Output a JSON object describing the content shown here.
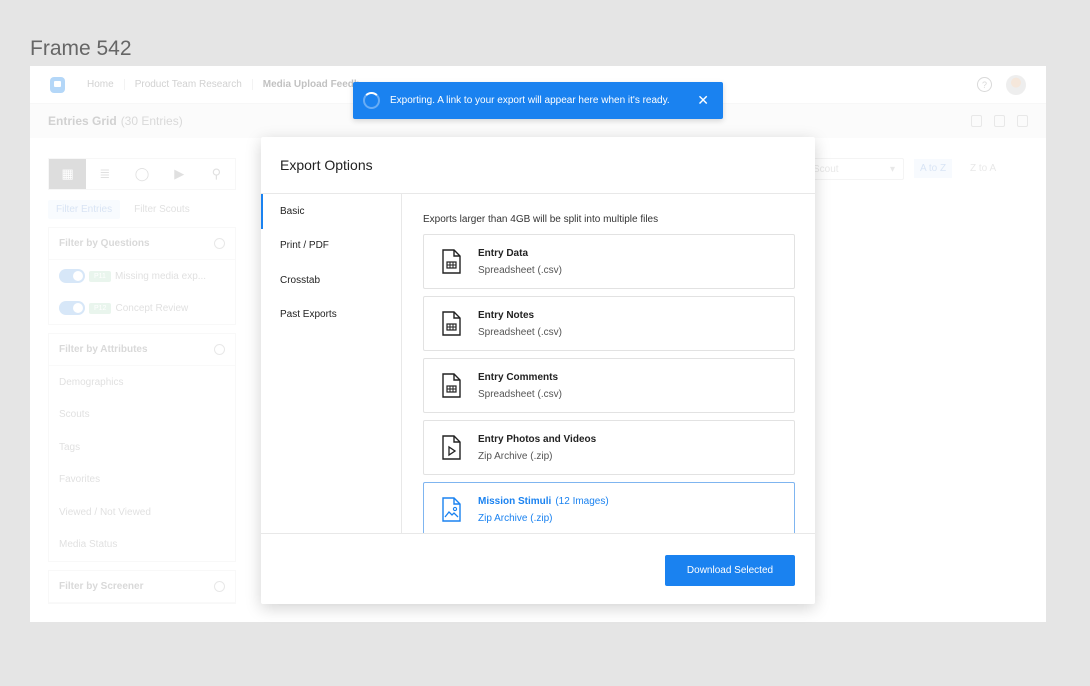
{
  "frame_label": "Frame 542",
  "nav": {
    "breadcrumbs": [
      "Home",
      "Product Team Research",
      "Media Upload Feedb"
    ]
  },
  "subbar": {
    "title": "Entries Grid",
    "count": "(30 Entries)"
  },
  "left": {
    "filter_tabs": [
      "Filter Entries",
      "Filter Scouts"
    ],
    "questions_head": "Filter by Questions",
    "questions": [
      {
        "badge": "P11",
        "label": "Missing media exp..."
      },
      {
        "badge": "P12",
        "label": "Concept Review"
      }
    ],
    "attributes_head": "Filter by Attributes",
    "attributes": [
      "Demographics",
      "Scouts",
      "Tags",
      "Favorites",
      "Viewed / Not Viewed",
      "Media Status"
    ],
    "screener_head": "Filter by Screener"
  },
  "sort": {
    "select": "Scout",
    "a_to_z": "A to Z",
    "z_to_a": "Z to A"
  },
  "toast": {
    "message": "Exporting. A link to your export will appear here when it's ready."
  },
  "modal": {
    "title": "Export Options",
    "side": [
      "Basic",
      "Print / PDF",
      "Crosstab",
      "Past Exports"
    ],
    "note": "Exports larger than 4GB will be split into multiple files",
    "options": [
      {
        "title": "Entry Data",
        "subtitle": "Spreadsheet (.csv)",
        "icon": "spreadsheet-icon"
      },
      {
        "title": "Entry Notes",
        "subtitle": "Spreadsheet (.csv)",
        "icon": "spreadsheet-icon"
      },
      {
        "title": "Entry Comments",
        "subtitle": "Spreadsheet (.csv)",
        "icon": "spreadsheet-icon"
      },
      {
        "title": "Entry Photos and Videos",
        "subtitle": "Zip Archive (.zip)",
        "icon": "video-file-icon"
      },
      {
        "title": "Mission Stimuli",
        "extra": "(12 Images)",
        "subtitle": "Zip Archive (.zip)",
        "icon": "image-file-icon"
      }
    ],
    "download_label": "Download Selected"
  },
  "colors": {
    "accent": "#1a82f0"
  }
}
